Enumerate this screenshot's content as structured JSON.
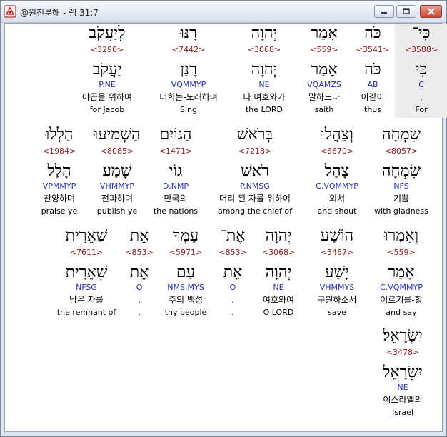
{
  "window": {
    "title": "@원전분해 - 렘 31:7",
    "minimize_icon": "minimize-icon",
    "maximize_icon": "maximize-icon",
    "close_icon": "close-icon"
  },
  "rows": [
    {
      "words": [
        {
          "hebrew": "כִּי־",
          "strong": "<3588>",
          "lemma": "כִּי",
          "code": "C",
          "korean": ".",
          "english": "For",
          "highlight": true
        },
        {
          "hebrew": "כֹּה",
          "strong": "<3541>",
          "lemma": "כֹּה",
          "code": "AB",
          "korean": "이같이",
          "english": "thus"
        },
        {
          "hebrew": "אָמַר",
          "strong": "<559>",
          "lemma": "אָמַר",
          "code": "VQAMZS",
          "korean": "말하노라",
          "english": "saith"
        },
        {
          "hebrew": "יְהוָה",
          "strong": "<3068>",
          "lemma": "יְהוָה",
          "code": "NE",
          "korean": "나 여호와가",
          "english": "the LORD"
        },
        {
          "hebrew": "רָנּוּ",
          "strong": "<7442>",
          "lemma": "רָנַן",
          "code": "VQMMYP",
          "korean": "너희는-노래하며",
          "english": "Sing"
        },
        {
          "hebrew": "לְיַעֲקֹב",
          "strong": "<3290>",
          "lemma": "יַעֲקֹב",
          "code": "P.NE",
          "korean": "야곱을 위하여",
          "english": "for Jacob"
        }
      ]
    },
    {
      "words": [
        {
          "hebrew": "שִׂמְחָה",
          "strong": "<8057>",
          "lemma": "שִׂמְחָה",
          "code": "NFS",
          "korean": "기쁨",
          "english": "with gladness"
        },
        {
          "hebrew": "וְצַהֲלוּ",
          "strong": "<6670>",
          "lemma": "צָהַל",
          "code": "C.VQMMYP",
          "korean": "외쳐",
          "english": "and shout"
        },
        {
          "hebrew": "בְּרֹאשׁ",
          "strong": "<7218>",
          "lemma": "רֹאשׁ",
          "code": "P.NMSG",
          "korean": "머리 된 자를 위하여",
          "english": "among the chief of"
        },
        {
          "hebrew": "הַגּוֹיִם",
          "strong": "<1471>",
          "lemma": "גּוֹי",
          "code": "D.NMP",
          "korean": "만국의",
          "english": "the nations"
        },
        {
          "hebrew": "הַשְׁמִיעוּ",
          "strong": "<8085>",
          "lemma": "שָׁמַע",
          "code": "VHMMYP",
          "korean": "전파하며",
          "english": "publish ye"
        },
        {
          "hebrew": "הַלְלוּ",
          "strong": "<1984>",
          "lemma": "הָלַל",
          "code": "VPMMYP",
          "korean": "찬양하며",
          "english": "praise ye"
        }
      ]
    },
    {
      "words": [
        {
          "hebrew": "וְאִמְרוּ",
          "strong": "<559>",
          "lemma": "אָמַר",
          "code": "C.VQMMYP",
          "korean": "이르기를-할",
          "english": "and say"
        },
        {
          "hebrew": "הוֹשַׁע",
          "strong": "<3467>",
          "lemma": "יָשַׁע",
          "code": "VHMMYS",
          "korean": "구원하소서",
          "english": "save"
        },
        {
          "hebrew": "יְהוָה",
          "strong": "<3068>",
          "lemma": "יְהוָה",
          "code": "NE",
          "korean": "여호와여",
          "english": "O LORD"
        },
        {
          "hebrew": "אֶת־",
          "strong": "<853>",
          "lemma": "אֵת",
          "code": "O",
          "korean": ".",
          "english": "."
        },
        {
          "hebrew": "עַמְּךָ",
          "strong": "<5971>",
          "lemma": "עַם",
          "code": "NMS.MYS",
          "korean": "주의 백성",
          "english": "thy people"
        },
        {
          "hebrew": "אֵת",
          "strong": "<853>",
          "lemma": "אֵת",
          "code": "O",
          "korean": ".",
          "english": "."
        },
        {
          "hebrew": "שְׁאֵרִית",
          "strong": "<7611>",
          "lemma": "שְׁאֵרִית",
          "code": "NFSG",
          "korean": "남은 자를",
          "english": "the remnant of"
        }
      ]
    },
    {
      "words": [
        {
          "hebrew": "יִשְׂרָאֵל׃",
          "strong": "<3478>",
          "lemma": "יִשְׂרָאֵל",
          "code": "NE",
          "korean": "이스라엘의",
          "english": "Israel"
        }
      ]
    }
  ]
}
